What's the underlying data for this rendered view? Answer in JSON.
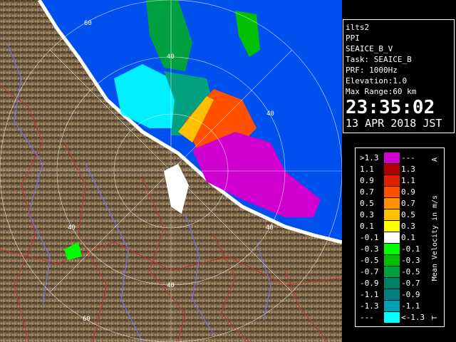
{
  "info": {
    "station": "ilts2",
    "scan_type": "PPI",
    "product": "SEAICE_B_V",
    "task": "Task: SEAICE_B",
    "prf": "PRF: 1000Hz",
    "elevation": "Elevation:1.0",
    "max_range": "Max Range:60 km",
    "time": "23:35:02",
    "date": "13 APR 2018 JST"
  },
  "legend": {
    "title": "Mean Velocity in m/s",
    "top_marker": "A",
    "bottom_marker": "T",
    "rows": [
      {
        "lo": ">1.3",
        "hi": "---",
        "color": "#d000d0"
      },
      {
        "lo": "1.1",
        "hi": "1.3",
        "color": "#b00000"
      },
      {
        "lo": "0.9",
        "hi": "1.1",
        "color": "#e02000"
      },
      {
        "lo": "0.7",
        "hi": "0.9",
        "color": "#ff5000"
      },
      {
        "lo": "0.5",
        "hi": "0.7",
        "color": "#ff9000"
      },
      {
        "lo": "0.3",
        "hi": "0.5",
        "color": "#ffc000"
      },
      {
        "lo": "0.1",
        "hi": "0.3",
        "color": "#ffff00"
      },
      {
        "lo": "-0.1",
        "hi": "0.1",
        "color": "#ffffff"
      },
      {
        "lo": "-0.3",
        "hi": "-0.1",
        "color": "#00ff00"
      },
      {
        "lo": "-0.5",
        "hi": "-0.3",
        "color": "#00c000"
      },
      {
        "lo": "-0.7",
        "hi": "-0.5",
        "color": "#00a040"
      },
      {
        "lo": "-0.9",
        "hi": "-0.7",
        "color": "#008060"
      },
      {
        "lo": "-1.1",
        "hi": "-0.9",
        "color": "#008080"
      },
      {
        "lo": "-1.3",
        "hi": "-1.1",
        "color": "#00a0b0"
      },
      {
        "lo": "---",
        "hi": "<-1.3",
        "color": "#00ffff"
      }
    ]
  },
  "map": {
    "range_labels": [
      "60",
      "40",
      "40",
      "40",
      "40",
      "40",
      "60"
    ],
    "colors": {
      "sea": "#0050f0",
      "land": "#7a6448",
      "road": "#c03030",
      "river": "#6060ff"
    }
  }
}
